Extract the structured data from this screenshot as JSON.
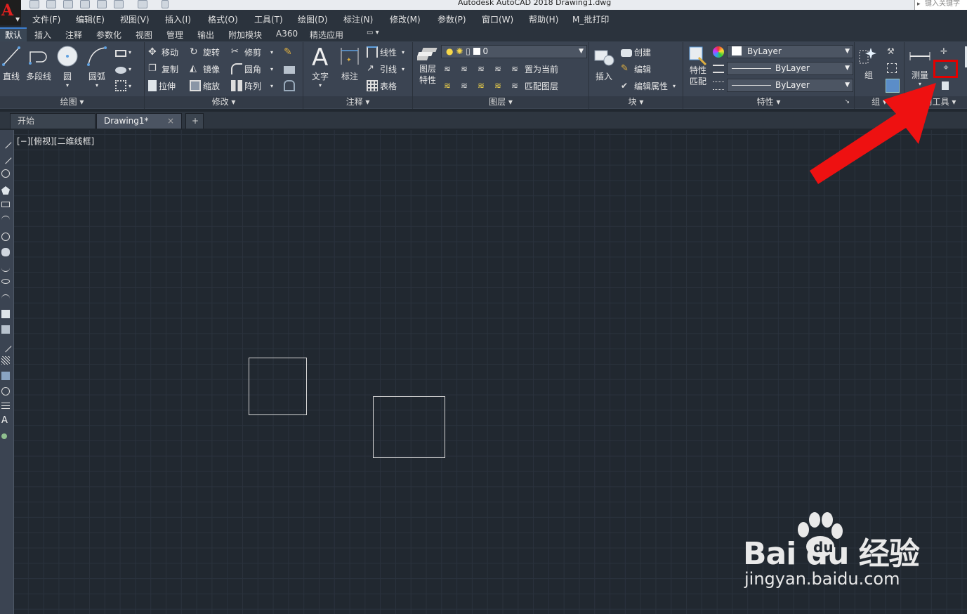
{
  "window": {
    "title": "Autodesk AutoCAD 2018     Drawing1.dwg",
    "search_placeholder": "键入关键字"
  },
  "app_logo": "A",
  "menu": [
    "文件(F)",
    "编辑(E)",
    "视图(V)",
    "插入(I)",
    "格式(O)",
    "工具(T)",
    "绘图(D)",
    "标注(N)",
    "修改(M)",
    "参数(P)",
    "窗口(W)",
    "帮助(H)",
    "M_批打印"
  ],
  "ribbon_tabs": [
    "默认",
    "插入",
    "注释",
    "参数化",
    "视图",
    "管理",
    "输出",
    "附加模块",
    "A360",
    "精选应用"
  ],
  "active_ribbon_tab": "默认",
  "panels": {
    "draw": {
      "title": "绘图",
      "line": "直线",
      "polyline": "多段线",
      "circle": "圆",
      "arc": "圆弧"
    },
    "modify": {
      "title": "修改",
      "move": "移动",
      "rotate": "旋转",
      "trim": "修剪",
      "copy": "复制",
      "mirror": "镜像",
      "fillet": "圆角",
      "stretch": "拉伸",
      "scale": "缩放",
      "array": "阵列"
    },
    "annotation": {
      "title": "注释",
      "text": "文字",
      "dimension": "标注",
      "linear": "线性",
      "leader": "引线",
      "table": "表格"
    },
    "layers": {
      "title": "图层",
      "layer_properties": "图层\n特性",
      "current_layer": "0",
      "set_current": "置为当前",
      "match_layer": "匹配图层"
    },
    "block": {
      "title": "块",
      "insert": "插入",
      "create": "创建",
      "edit": "编辑",
      "edit_attributes": "编辑属性"
    },
    "properties": {
      "title": "特性",
      "match": "特性\n匹配",
      "color": "ByLayer",
      "linetype": "ByLayer",
      "lineweight": "ByLayer"
    },
    "groups": {
      "title": "组",
      "group": "组"
    },
    "utilities": {
      "title": "实用工具",
      "measure": "测量"
    }
  },
  "doc_tabs": [
    {
      "label": "开始",
      "active": false
    },
    {
      "label": "Drawing1*",
      "active": true
    }
  ],
  "new_tab_symbol": "+",
  "close_symbol": "×",
  "viewport_label": "[−][俯视][二维线框]",
  "watermark": {
    "brand": "Bai  du 经验",
    "url": "jingyan.baidu.com"
  },
  "colors": {
    "canvas": "#212830",
    "ribbon": "#3b4452",
    "annotation_arrow": "#e30000"
  }
}
